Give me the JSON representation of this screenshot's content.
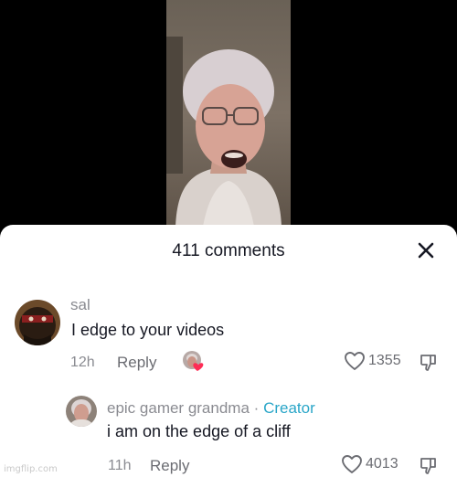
{
  "sheet": {
    "title": "411 comments",
    "close_icon": "close-icon"
  },
  "comments": [
    {
      "username": "sal",
      "text": "I edge to your videos",
      "time": "12h",
      "reply_label": "Reply",
      "likes": "1355",
      "creator_liked": true
    },
    {
      "username": "epic gamer grandma",
      "separator": "·",
      "badge": "Creator",
      "text": "i am on the edge of a cliff",
      "time": "11h",
      "reply_label": "Reply",
      "likes": "4013"
    }
  ],
  "watermark": "imgflip.com",
  "colors": {
    "creator_badge": "#2aa6c8",
    "heart_red": "#fe2c55",
    "muted_text": "#8a8b91",
    "primary_text": "#161823"
  }
}
